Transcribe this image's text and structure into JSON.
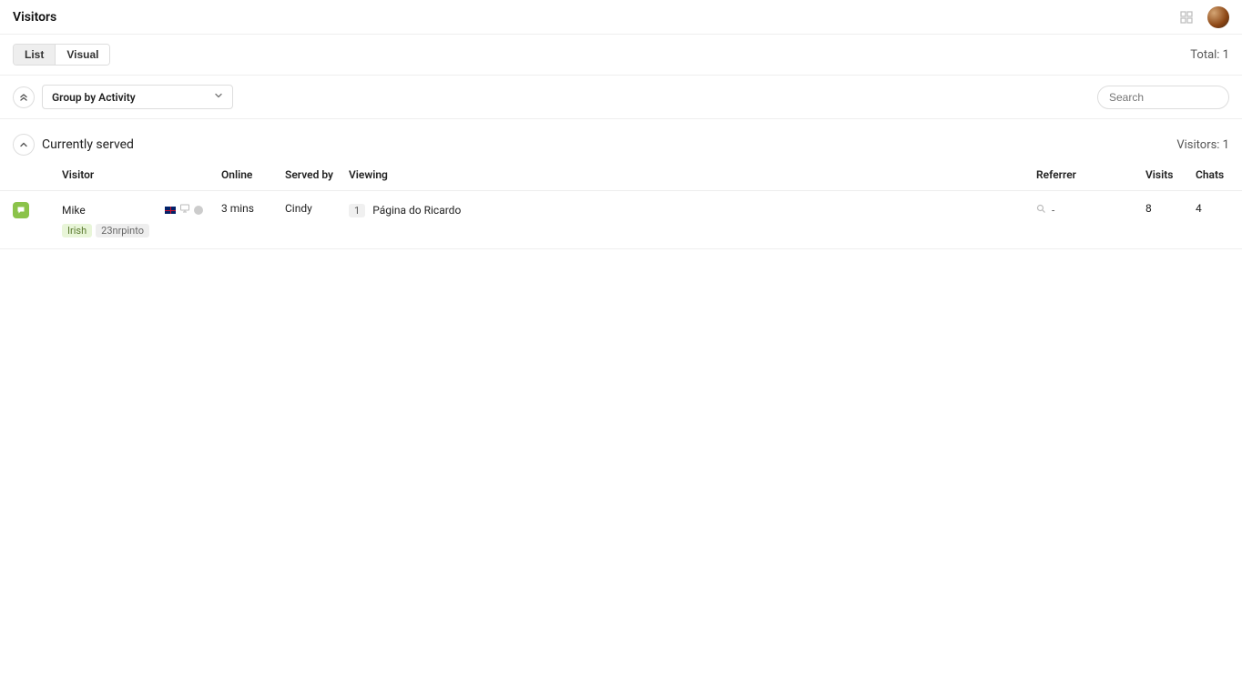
{
  "header": {
    "title": "Visitors"
  },
  "viewbar": {
    "tabs": [
      "List",
      "Visual"
    ],
    "active_tab": "List",
    "total_label": "Total: 1"
  },
  "filterbar": {
    "group_by": "Group by Activity",
    "search_placeholder": "Search"
  },
  "group": {
    "title": "Currently served",
    "count_label": "Visitors: 1"
  },
  "columns": [
    "Visitor",
    "Online",
    "Served by",
    "Viewing",
    "Referrer",
    "Visits",
    "Chats"
  ],
  "rows": [
    {
      "name": "Mike",
      "tags": [
        {
          "text": "Irish",
          "style": "green"
        },
        {
          "text": "23nrpinto",
          "style": "grey"
        }
      ],
      "online": "3 mins",
      "served_by": "Cindy",
      "page_count": "1",
      "viewing": "Página do Ricardo",
      "referrer": "-",
      "visits": "8",
      "chats": "4"
    }
  ]
}
